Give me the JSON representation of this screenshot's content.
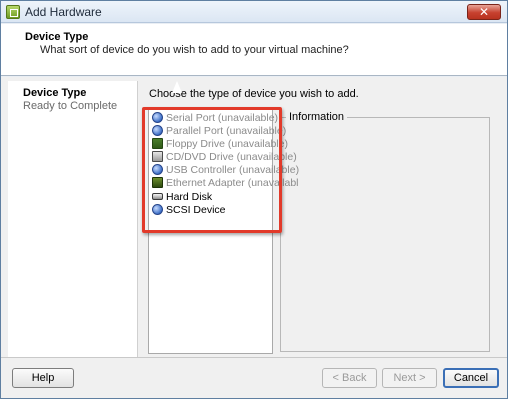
{
  "window": {
    "title": "Add Hardware",
    "close_label": "✕"
  },
  "header": {
    "title": "Device Type",
    "subtitle": "What sort of device do you wish to add to your virtual machine?"
  },
  "steps": [
    {
      "label": "Device Type",
      "state": "active"
    },
    {
      "label": "Ready to Complete",
      "state": "inactive"
    }
  ],
  "instruction": "Choose the type of device you wish to add.",
  "devices": [
    {
      "label": "Serial Port (unavailable)",
      "icon": "serial-port-icon",
      "available": false
    },
    {
      "label": "Parallel Port (unavailable)",
      "icon": "parallel-port-icon",
      "available": false
    },
    {
      "label": "Floppy Drive (unavailable)",
      "icon": "floppy-drive-icon",
      "available": false
    },
    {
      "label": "CD/DVD Drive (unavailable)",
      "icon": "cd-dvd-drive-icon",
      "available": false
    },
    {
      "label": "USB Controller (unavailable)",
      "icon": "usb-controller-icon",
      "available": false
    },
    {
      "label": "Ethernet Adapter (unavailabl",
      "icon": "ethernet-adapter-icon",
      "available": false
    },
    {
      "label": "Hard Disk",
      "icon": "hard-disk-icon",
      "available": true
    },
    {
      "label": "SCSI Device",
      "icon": "scsi-device-icon",
      "available": true
    }
  ],
  "information": {
    "label": "Information"
  },
  "buttons": {
    "help": "Help",
    "back": "< Back",
    "next": "Next >",
    "cancel": "Cancel"
  },
  "colors": {
    "highlight_border": "#e23a2a",
    "unavailable_text": "#8b8b8b"
  }
}
